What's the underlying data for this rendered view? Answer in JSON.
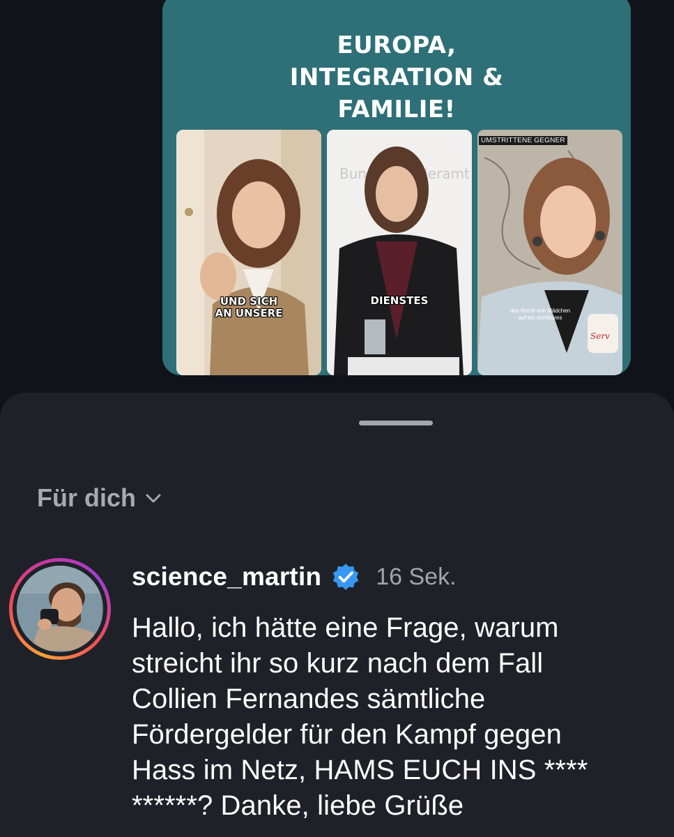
{
  "post": {
    "title_lines": [
      "EUROPA,",
      "INTEGRATION &",
      "FAMILIE!"
    ],
    "thumbnails": [
      {
        "caption_lines": [
          "UND SICH",
          "AN UNSERE"
        ]
      },
      {
        "caption_lines": [
          "DIENSTES"
        ],
        "background_text": "Bundeskanzleramt"
      },
      {
        "top_label": "UMSTRITTENE GEGNER",
        "subtitle_lines": [
          "das Recht von Mädchen",
          "auf ein sichtbares"
        ]
      }
    ]
  },
  "feed_filter": {
    "label": "Für dich",
    "icon": "chevron-down-icon"
  },
  "comment": {
    "username": "science_martin",
    "verified": true,
    "timestamp": "16 Sek.",
    "text": "Hallo, ich hätte eine Frage, warum\nstreicht ihr so kurz nach dem Fall\nCollien Fernandes sämtliche\nFördergelder für den Kampf gegen\nHass im Netz, HAMS EUCH INS ****\n******? Danke, liebe Grüße",
    "avatar_icon": "user-avatar"
  },
  "colors": {
    "page_background": "#0d1117",
    "card_teal": "#2e6f78",
    "sheet_background": "#1f2128",
    "verified_blue": "#3897f0",
    "muted_text": "#a8aab0"
  }
}
